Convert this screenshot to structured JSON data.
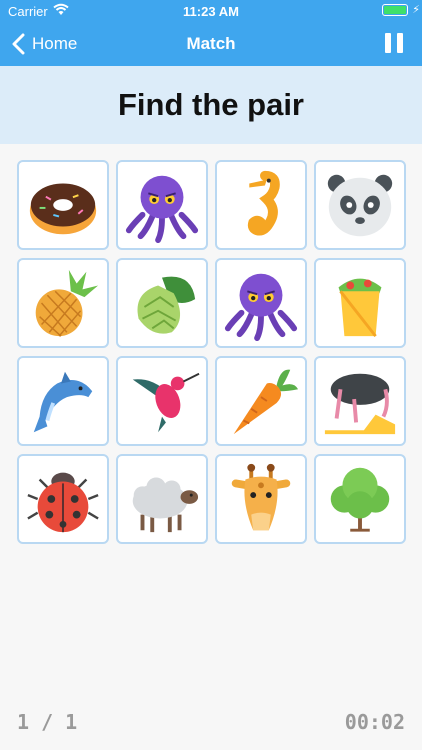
{
  "status_bar": {
    "carrier": "Carrier",
    "time": "11:23 AM"
  },
  "nav": {
    "back_label": "Home",
    "title": "Match"
  },
  "banner": {
    "title": "Find the pair"
  },
  "cards": [
    {
      "icon": "donut-icon"
    },
    {
      "icon": "octopus-icon"
    },
    {
      "icon": "seahorse-icon"
    },
    {
      "icon": "panda-icon"
    },
    {
      "icon": "pineapple-icon"
    },
    {
      "icon": "hop-icon"
    },
    {
      "icon": "octopus-icon"
    },
    {
      "icon": "burrito-icon"
    },
    {
      "icon": "dolphin-icon"
    },
    {
      "icon": "hummingbird-icon"
    },
    {
      "icon": "carrot-icon"
    },
    {
      "icon": "ostrich-icon"
    },
    {
      "icon": "ladybug-icon"
    },
    {
      "icon": "sheep-icon"
    },
    {
      "icon": "giraffe-icon"
    },
    {
      "icon": "tree-icon"
    }
  ],
  "footer": {
    "progress": "1 / 1",
    "timer": "00:02"
  },
  "colors": {
    "nav": "#3fa6ee",
    "banner": "#dcecf9",
    "card_border": "#b9d8f2"
  }
}
